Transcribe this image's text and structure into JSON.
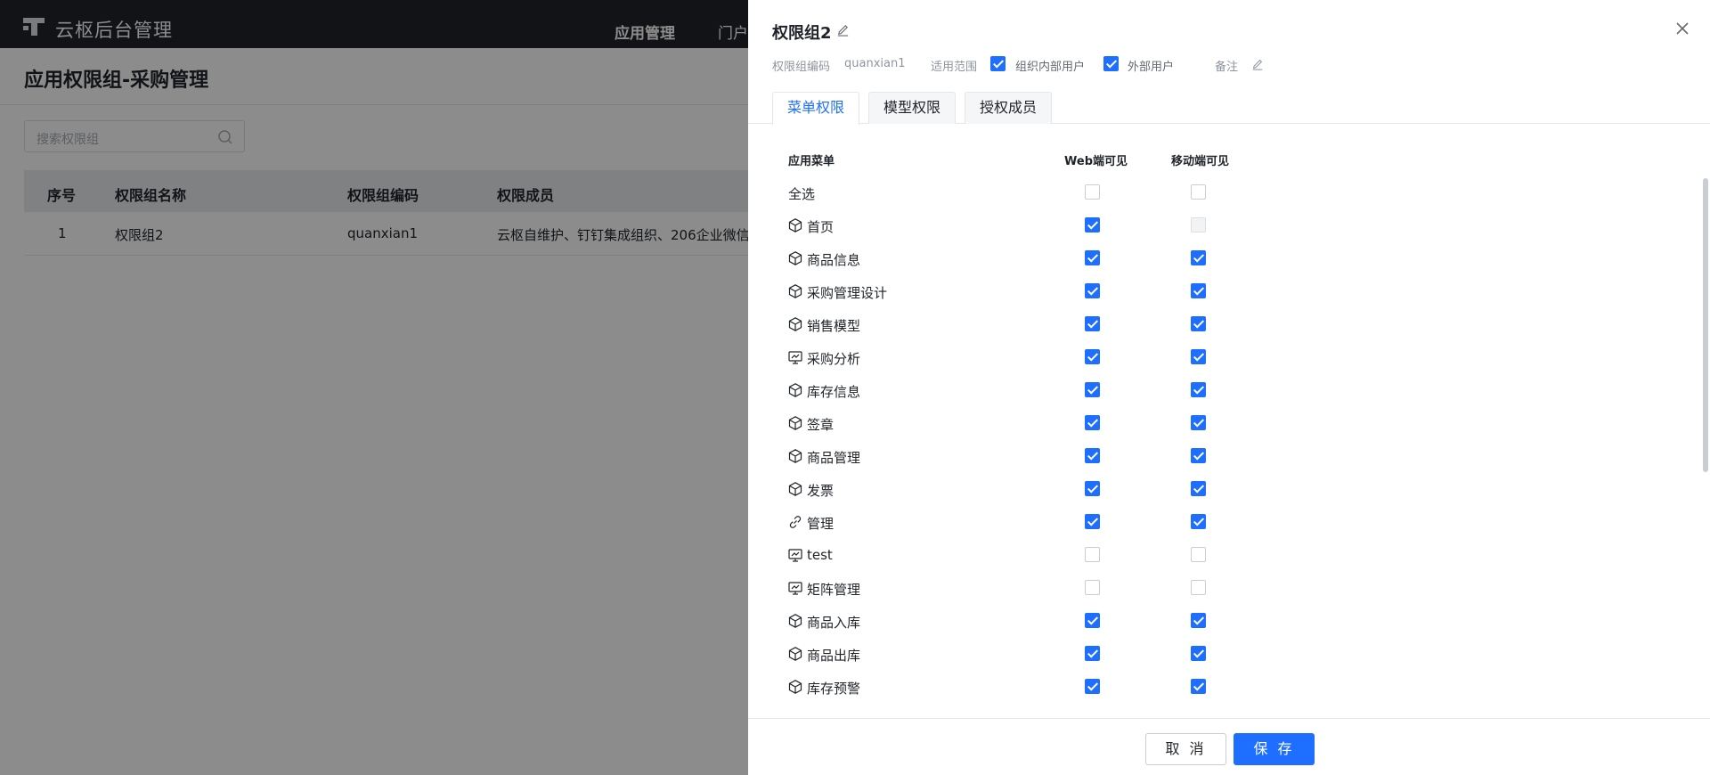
{
  "app": {
    "title": "云枢后台管理",
    "nav": [
      "应用管理",
      "门户"
    ]
  },
  "page": {
    "title": "应用权限组-采购管理",
    "search_placeholder": "搜索权限组"
  },
  "table": {
    "columns": [
      "序号",
      "权限组名称",
      "权限组编码",
      "权限成员"
    ],
    "rows": [
      {
        "index": "1",
        "name": "权限组2",
        "code": "quanxian1",
        "members": "云枢自维护、钉钉集成组织、206企业微信"
      }
    ]
  },
  "drawer": {
    "title": "权限组2",
    "code_label": "权限组编码",
    "code_value": "quanxian1",
    "scope_label": "适用范围",
    "scope_options": [
      {
        "label": "组织内部用户",
        "checked": true
      },
      {
        "label": "外部用户",
        "checked": true
      }
    ],
    "remark_label": "备注",
    "tabs": [
      "菜单权限",
      "模型权限",
      "授权成员"
    ],
    "active_tab": 0,
    "headers": {
      "menu": "应用菜单",
      "web": "Web端可见",
      "mobile": "移动端可见"
    },
    "rows": [
      {
        "label": "全选",
        "icon": "none",
        "web": "off",
        "mobile": "off"
      },
      {
        "label": "首页",
        "icon": "cube-icon",
        "web": "on",
        "mobile": "dis"
      },
      {
        "label": "商品信息",
        "icon": "cube-icon",
        "web": "on",
        "mobile": "on"
      },
      {
        "label": "采购管理设计",
        "icon": "cube-icon",
        "web": "on",
        "mobile": "on"
      },
      {
        "label": "销售模型",
        "icon": "cube-icon",
        "web": "on",
        "mobile": "on"
      },
      {
        "label": "采购分析",
        "icon": "monitor-chart-icon",
        "web": "on",
        "mobile": "on"
      },
      {
        "label": "库存信息",
        "icon": "cube-icon",
        "web": "on",
        "mobile": "on"
      },
      {
        "label": "签章",
        "icon": "cube-icon",
        "web": "on",
        "mobile": "on"
      },
      {
        "label": "商品管理",
        "icon": "cube-icon",
        "web": "on",
        "mobile": "on"
      },
      {
        "label": "发票",
        "icon": "cube-icon",
        "web": "on",
        "mobile": "on"
      },
      {
        "label": "管理",
        "icon": "link-icon",
        "web": "on",
        "mobile": "on"
      },
      {
        "label": "test",
        "icon": "monitor-chart-icon",
        "web": "off",
        "mobile": "off"
      },
      {
        "label": "矩阵管理",
        "icon": "monitor-chart-icon",
        "web": "off",
        "mobile": "off"
      },
      {
        "label": "商品入库",
        "icon": "cube-icon",
        "web": "on",
        "mobile": "on"
      },
      {
        "label": "商品出库",
        "icon": "cube-icon",
        "web": "on",
        "mobile": "on"
      },
      {
        "label": "库存预警",
        "icon": "cube-icon",
        "web": "on",
        "mobile": "on"
      }
    ],
    "cancel_label": "取 消",
    "save_label": "保 存"
  },
  "colors": {
    "accent": "#1e6fff",
    "topbar": "#1f2329",
    "overlay": "rgba(0,0,0,0.45)"
  }
}
